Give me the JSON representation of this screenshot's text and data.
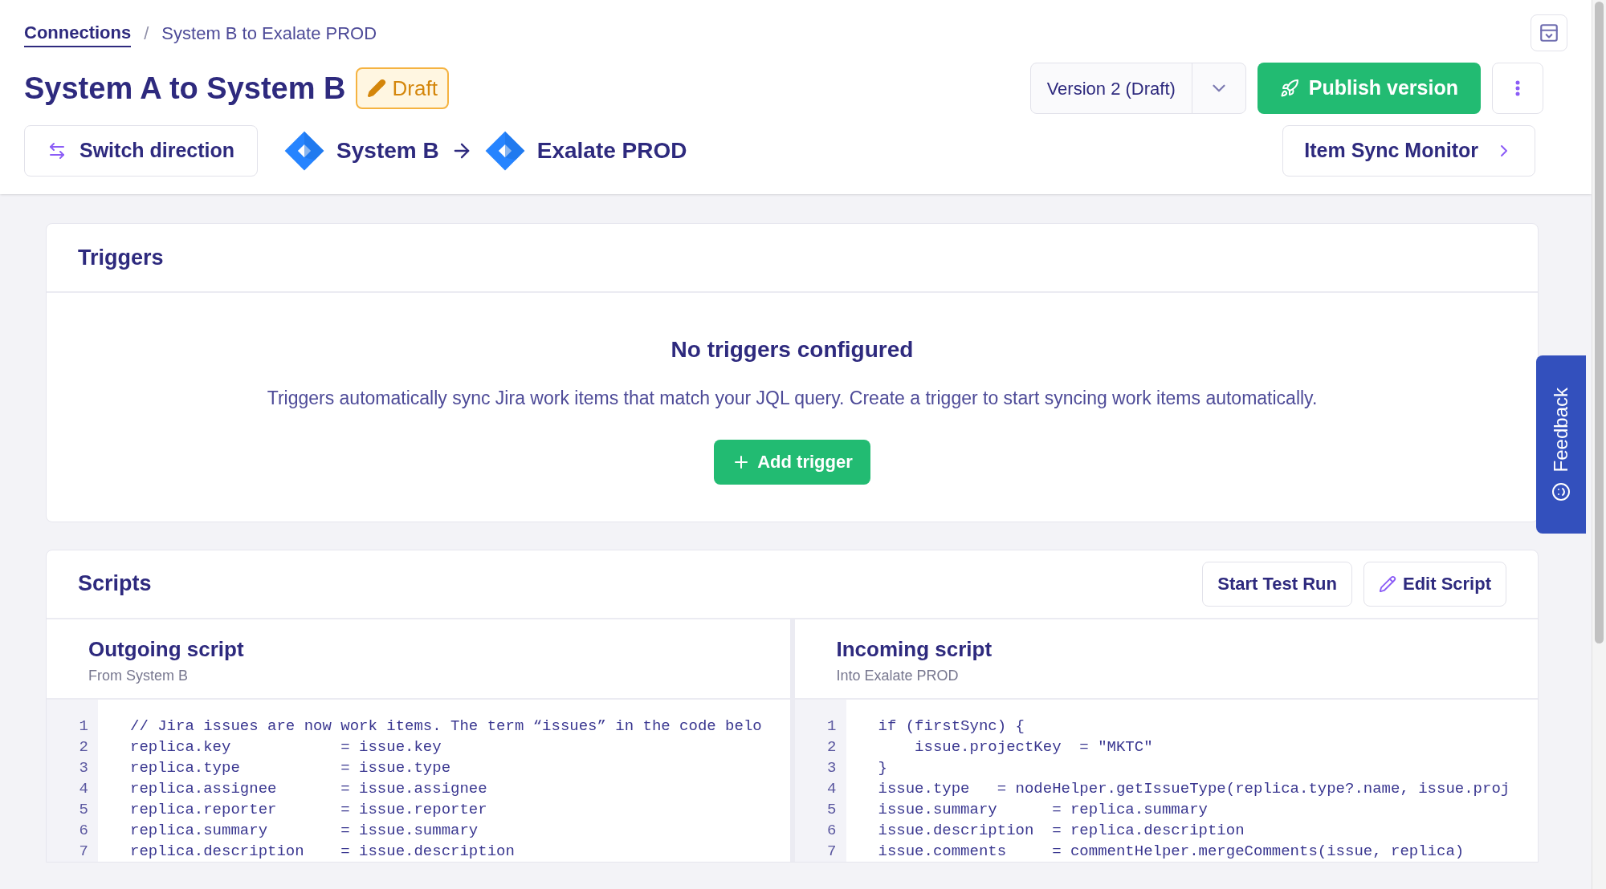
{
  "breadcrumb": {
    "link": "Connections",
    "separator": "/",
    "current": "System B to Exalate PROD"
  },
  "title": "System A to System B",
  "status_badge": {
    "label": "Draft"
  },
  "version_select": {
    "value": "Version 2 (Draft)"
  },
  "publish_button": {
    "label": "Publish version"
  },
  "switch_button": {
    "label": "Switch direction"
  },
  "route": {
    "source": "System B",
    "target": "Exalate PROD"
  },
  "monitor_button": {
    "label": "Item Sync Monitor"
  },
  "triggers": {
    "title": "Triggers",
    "empty_title": "No triggers configured",
    "empty_text": "Triggers automatically sync Jira work items that match your JQL query. Create a trigger to start syncing work items automatically.",
    "add_button": "Add trigger"
  },
  "scripts": {
    "title": "Scripts",
    "buttons": [
      {
        "label": "Start Test Run",
        "kind": "plain"
      },
      {
        "label": "Edit Script",
        "kind": "edit"
      }
    ],
    "panels": [
      {
        "title": "Outgoing script",
        "subtitle": "From System B",
        "lines": [
          {
            "number": "1",
            "code": "// Jira issues are now work items. The term “issues” in the code belo"
          },
          {
            "number": "2",
            "code": "replica.key            = issue.key"
          },
          {
            "number": "3",
            "code": "replica.type           = issue.type"
          },
          {
            "number": "4",
            "code": "replica.assignee       = issue.assignee"
          },
          {
            "number": "5",
            "code": "replica.reporter       = issue.reporter"
          },
          {
            "number": "6",
            "code": "replica.summary        = issue.summary"
          },
          {
            "number": "7",
            "code": "replica.description    = issue.description"
          }
        ]
      },
      {
        "title": "Incoming script",
        "subtitle": "Into Exalate PROD",
        "lines": [
          {
            "number": "1",
            "code": "if (firstSync) {"
          },
          {
            "number": "2",
            "code": "    issue.projectKey  = \"MKTC\""
          },
          {
            "number": "3",
            "code": "}"
          },
          {
            "number": "4",
            "code": "issue.type   = nodeHelper.getIssueType(replica.type?.name, issue.proj"
          },
          {
            "number": "5",
            "code": "issue.summary      = replica.summary"
          },
          {
            "number": "6",
            "code": "issue.description  = replica.description"
          },
          {
            "number": "7",
            "code": "issue.comments     = commentHelper.mergeComments(issue, replica)"
          }
        ]
      }
    ]
  },
  "feedback": {
    "label": "Feedback"
  }
}
